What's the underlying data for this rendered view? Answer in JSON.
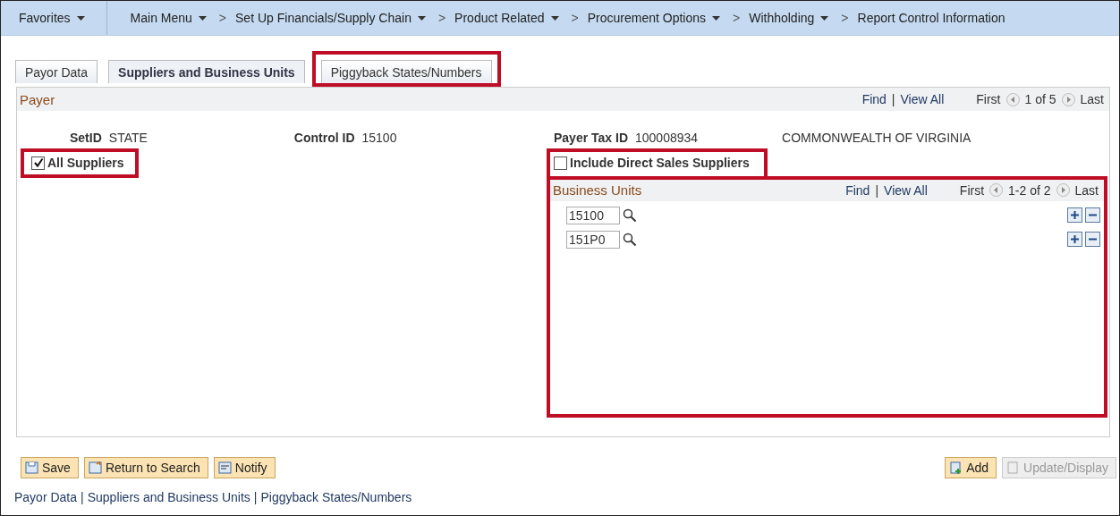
{
  "nav": [
    {
      "label": "Favorites",
      "kind": "favorites",
      "dropdown": true
    },
    {
      "label": "Main Menu",
      "kind": "menu",
      "dropdown": true
    },
    {
      "label": "Set Up Financials/Supply Chain",
      "kind": "crumb",
      "separator": ">",
      "dropdown": true
    },
    {
      "label": "Product Related",
      "kind": "crumb",
      "separator": ">",
      "dropdown": true
    },
    {
      "label": "Procurement Options",
      "kind": "crumb",
      "separator": ">",
      "dropdown": true
    },
    {
      "label": "Withholding",
      "kind": "crumb",
      "separator": ">",
      "dropdown": true
    },
    {
      "label": "Report Control Information",
      "kind": "crumb",
      "separator": ">",
      "dropdown": false
    }
  ],
  "tabs": [
    {
      "label": "Payor Data",
      "selected": false,
      "highlighted": false
    },
    {
      "label": "Suppliers and Business Units",
      "selected": true,
      "highlighted": false
    },
    {
      "label": "Piggyback States/Numbers",
      "selected": false,
      "highlighted": true
    }
  ],
  "payer": {
    "title": "Payer",
    "find": "Find",
    "divider": "|",
    "view_all": "View All",
    "first": "First",
    "range": "1 of 5",
    "last": "Last",
    "setid_label": "SetID",
    "setid": "STATE",
    "control_label": "Control ID",
    "control_id": "15100",
    "tax_label": "Payer Tax ID",
    "tax_id": "100008934",
    "payer_name": "COMMONWEALTH OF VIRGINIA",
    "checkboxes": [
      {
        "label": "All Suppliers",
        "checked": true,
        "highlighted": true
      },
      {
        "label": "Include Direct Sales Suppliers",
        "checked": false,
        "highlighted": true
      }
    ],
    "business_units": {
      "title": "Business Units",
      "find": "Find",
      "divider": "|",
      "view_all": "View All",
      "first": "First",
      "range": "1-2 of 2",
      "last": "Last",
      "highlighted": true,
      "rows": [
        {
          "value": "15100"
        },
        {
          "value": "151P0"
        }
      ]
    }
  },
  "buttons_left": [
    {
      "label": "Save",
      "kind": "save",
      "disabled": false
    },
    {
      "label": "Return to Search",
      "kind": "return",
      "disabled": false
    },
    {
      "label": "Notify",
      "kind": "notify",
      "disabled": false
    }
  ],
  "buttons_right": [
    {
      "label": "Add",
      "kind": "add",
      "disabled": false
    },
    {
      "label": "Update/Display",
      "kind": "update",
      "disabled": true
    }
  ],
  "footer_divider": "|",
  "footer_links": [
    "Payor Data",
    "Suppliers and Business Units",
    "Piggyback States/Numbers"
  ]
}
